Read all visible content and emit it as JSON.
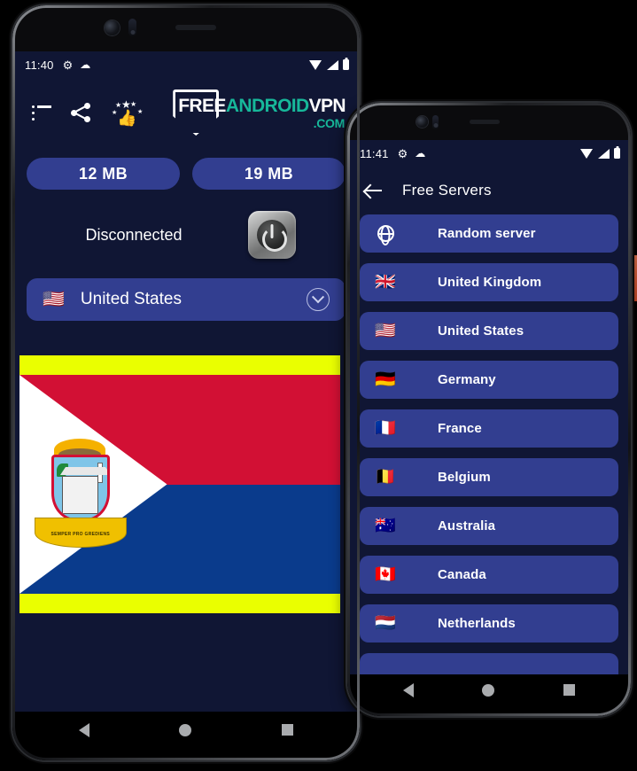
{
  "phone1": {
    "statusbar": {
      "time": "11:40",
      "gear_icon": "gear-icon",
      "cloud_icon": "cloud-icon",
      "wifi_icon": "wifi-icon",
      "signal_icon": "signal-icon",
      "battery_icon": "battery-icon"
    },
    "toolbar": {
      "list_icon": "list-menu-icon",
      "share_icon": "share-icon",
      "rate_icon": "thumbs-up-stars-icon",
      "logo": {
        "part1": "FREE",
        "part2": "ANDROID",
        "part3": "VPN",
        "part4": ".COM",
        "shield_icon": "shield-icon"
      }
    },
    "usage": {
      "download": "12 MB",
      "upload": "19 MB"
    },
    "connection": {
      "status": "Disconnected",
      "power_icon": "power-button-icon"
    },
    "server_select": {
      "flag": "🇺🇸",
      "name": "United States",
      "chevron_icon": "chevron-down-icon"
    },
    "ad_banner": {
      "flag_name": "Sint Maarten flag",
      "motto": "SEMPER PRO GREDIENS",
      "background_color": "#eaff00",
      "red": "#d21034",
      "blue": "#0a3b8c"
    },
    "navbar": {
      "back": "back-nav-icon",
      "home": "home-nav-icon",
      "recents": "recents-nav-icon"
    }
  },
  "phone2": {
    "statusbar": {
      "time": "11:41",
      "gear_icon": "gear-icon",
      "cloud_icon": "cloud-icon",
      "wifi_icon": "wifi-icon",
      "signal_icon": "signal-icon",
      "battery_icon": "battery-icon"
    },
    "appbar": {
      "back_icon": "back-arrow-icon",
      "title": "Free Servers"
    },
    "servers": [
      {
        "flag": "",
        "name": "Random server",
        "icon": "globe-icon"
      },
      {
        "flag": "🇬🇧",
        "name": "United Kingdom",
        "icon": "flag-icon"
      },
      {
        "flag": "🇺🇸",
        "name": "United States",
        "icon": "flag-icon"
      },
      {
        "flag": "🇩🇪",
        "name": "Germany",
        "icon": "flag-icon"
      },
      {
        "flag": "🇫🇷",
        "name": "France",
        "icon": "flag-icon"
      },
      {
        "flag": "🇧🇪",
        "name": "Belgium",
        "icon": "flag-icon"
      },
      {
        "flag": "🇦🇺",
        "name": "Australia",
        "icon": "flag-icon"
      },
      {
        "flag": "🇨🇦",
        "name": "Canada",
        "icon": "flag-icon"
      },
      {
        "flag": "🇳🇱",
        "name": "Netherlands",
        "icon": "flag-icon"
      },
      {
        "flag": "",
        "name": "",
        "icon": "flag-icon"
      }
    ],
    "navbar": {
      "back": "back-nav-icon",
      "home": "home-nav-icon",
      "recents": "recents-nav-icon"
    }
  },
  "colors": {
    "screen_bg": "#101634",
    "pill": "#323e90",
    "accent_teal": "#17b89a",
    "edge_sliver": "#e8613b"
  }
}
